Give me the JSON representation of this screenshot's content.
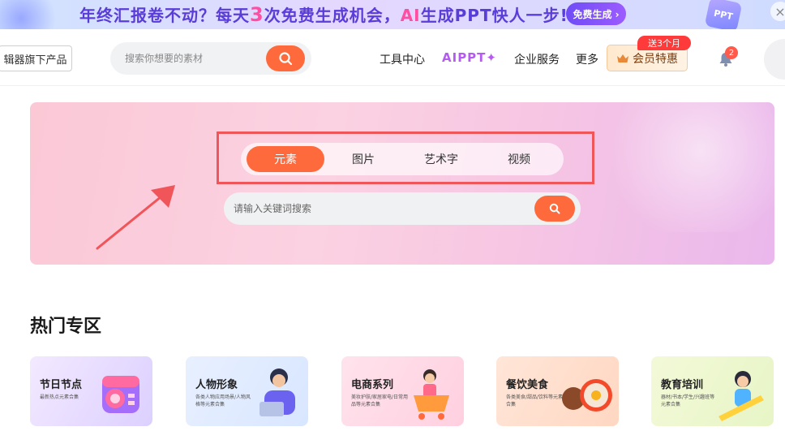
{
  "promo": {
    "text_pre": "年终汇报卷不动？每天",
    "text_num": "3",
    "text_mid": "次免费生成机会，",
    "text_ai": "AI",
    "text_post": "生成PPT快人一步!",
    "button": "免费生成 ›",
    "ppt_badge": "PPT",
    "close_icon": "close-icon"
  },
  "nav": {
    "editor_button": "辑器旗下产品",
    "search_placeholder": "搜索你想要的素材",
    "links": {
      "tools": "工具中心",
      "aippt": "AIPPT✦",
      "enterprise": "企业服务",
      "more": "更多"
    },
    "vip": {
      "label": "会员特惠",
      "badge": "送3个月"
    },
    "notifications": "2"
  },
  "hero": {
    "tabs": [
      {
        "label": "元素",
        "active": true
      },
      {
        "label": "图片",
        "active": false
      },
      {
        "label": "艺术字",
        "active": false
      },
      {
        "label": "视频",
        "active": false
      }
    ],
    "search_placeholder": "请输入关键词搜索"
  },
  "hot": {
    "title": "热门专区",
    "cards": [
      {
        "title": "节日节点",
        "sub": "最新热点元素合集",
        "bg": "linear-gradient(120deg,#f3e9ff,#dcd0ff)"
      },
      {
        "title": "人物形象",
        "sub": "各类人物应用场景/人物风格等元素合集",
        "bg": "linear-gradient(120deg,#e8f0ff,#d8e6ff)"
      },
      {
        "title": "电商系列",
        "sub": "美妆护肤/家居家电/日常用品等元素合集",
        "bg": "linear-gradient(120deg,#ffe3ec,#ffd0e0)"
      },
      {
        "title": "餐饮美食",
        "sub": "各类美食/甜品/饮料等元素合集",
        "bg": "linear-gradient(120deg,#ffe6d8,#ffd7c2)"
      },
      {
        "title": "教育培训",
        "sub": "器材/书本/学生/兴趣班等元素合集",
        "bg": "linear-gradient(120deg,#f3f9d8,#e7f5c6)"
      }
    ]
  },
  "colors": {
    "accent": "#ff6a3d",
    "highlight_box": "#f0555a",
    "aippt": "#b45cf0"
  }
}
